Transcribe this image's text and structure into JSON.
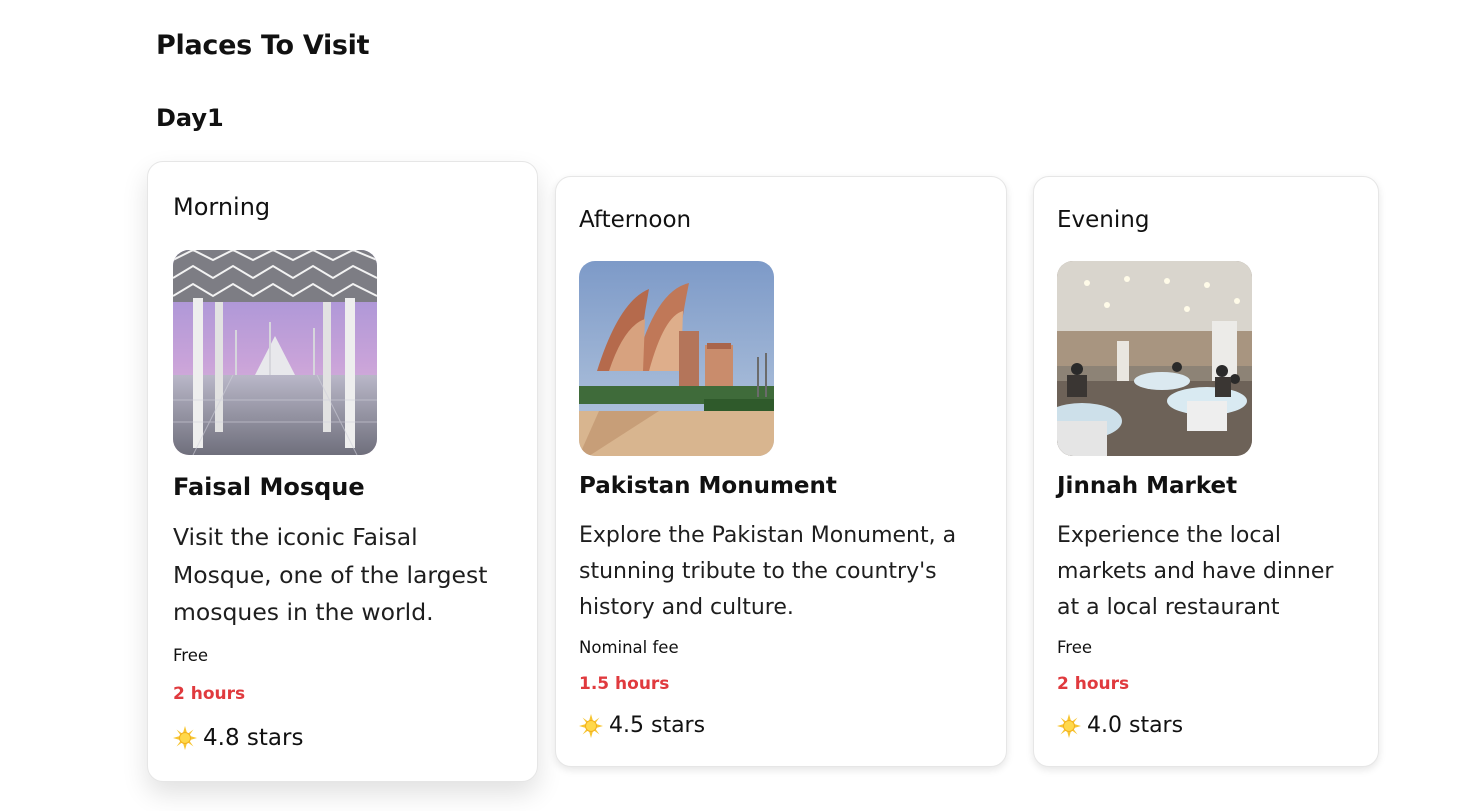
{
  "page": {
    "title": "Places To Visit"
  },
  "day": {
    "title": "Day1"
  },
  "colors": {
    "duration": "#e03a3e",
    "card_border": "#e6e6e6",
    "text": "#111111"
  },
  "cards": [
    {
      "time_of_day": "Morning",
      "image_icon": "faisal-mosque-photo",
      "place": "Faisal Mosque",
      "description": "Visit the iconic Faisal Mosque, one of the largest mosques in the world.",
      "cost": "Free",
      "duration": "2 hours",
      "rating_icon": "sun-icon",
      "rating": "4.8 stars"
    },
    {
      "time_of_day": "Afternoon",
      "image_icon": "pakistan-monument-photo",
      "place": "Pakistan Monument",
      "description": "Explore the Pakistan Monument, a stunning tribute to the country's history and culture.",
      "cost": "Nominal fee",
      "duration": "1.5 hours",
      "rating_icon": "sun-icon",
      "rating": "4.5 stars"
    },
    {
      "time_of_day": "Evening",
      "image_icon": "jinnah-market-photo",
      "place": "Jinnah Market",
      "description": "Experience the local markets and have dinner at a local restaurant",
      "cost": "Free",
      "duration": "2 hours",
      "rating_icon": "sun-icon",
      "rating": "4.0 stars"
    }
  ]
}
